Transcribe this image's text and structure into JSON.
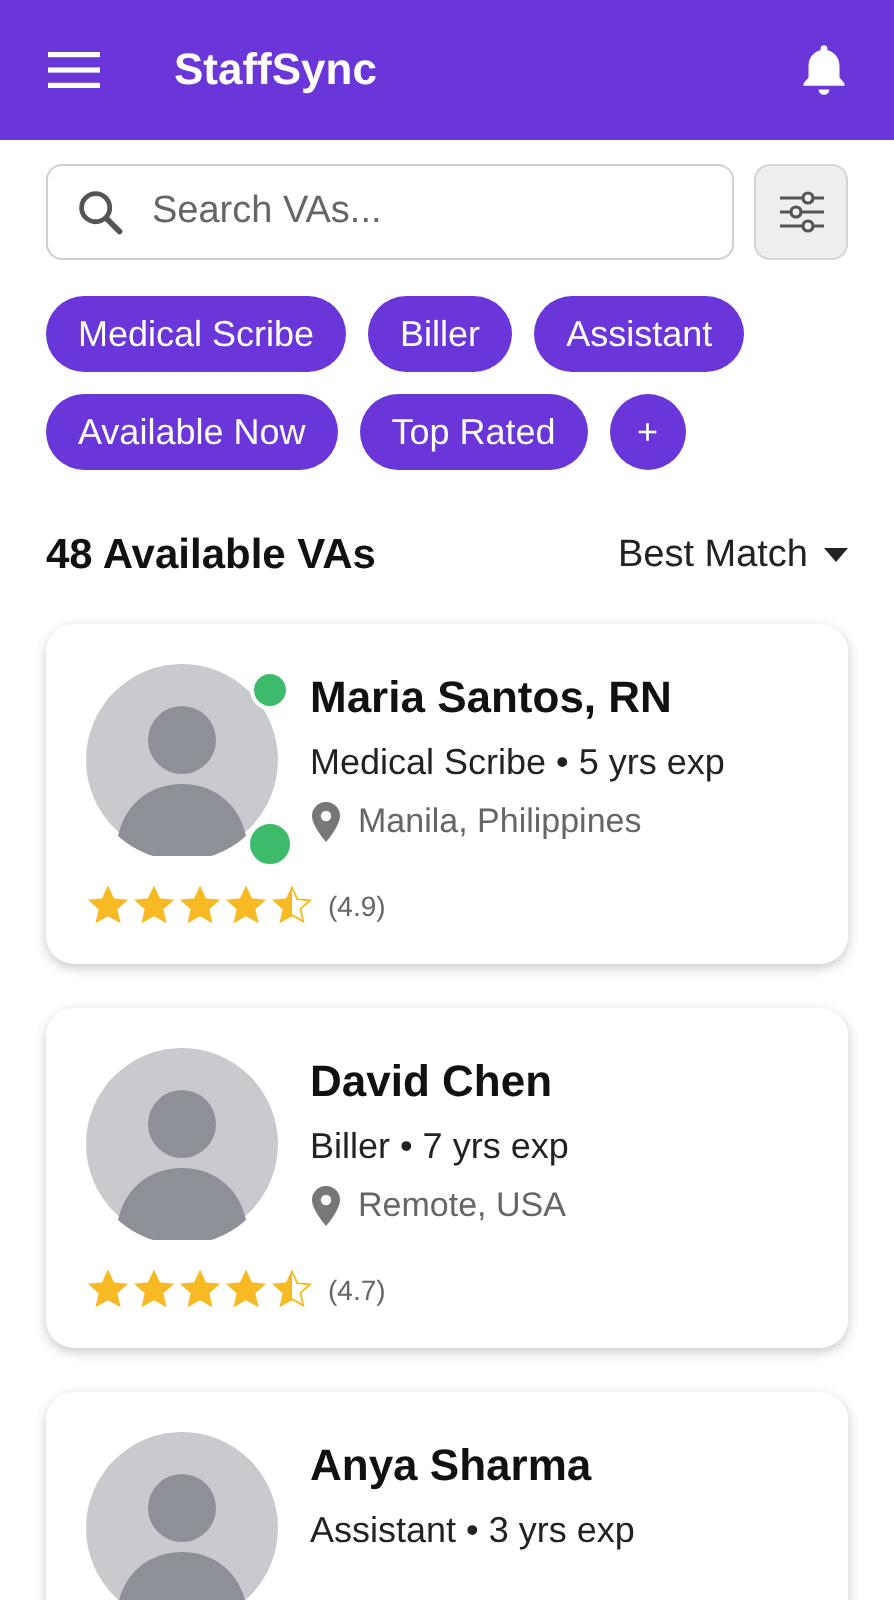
{
  "app_bar": {
    "title": "StaffSync"
  },
  "search": {
    "placeholder": "Search VAs..."
  },
  "chips": [
    {
      "label": "Medical Scribe"
    },
    {
      "label": "Biller"
    },
    {
      "label": "Assistant"
    },
    {
      "label": "Available Now"
    },
    {
      "label": "Top Rated"
    },
    {
      "label": "+"
    }
  ],
  "results": {
    "count_label": "48 Available VAs",
    "sort": "Best Match"
  },
  "cards": [
    {
      "name": "Maria Santos, RN",
      "role": "Medical Scribe • 5 yrs exp",
      "location": "Manila, Philippines",
      "stars": 4.5,
      "rating": "(4.9)",
      "online": true,
      "badge": true
    },
    {
      "name": "David Chen",
      "role": "Biller • 7 yrs exp",
      "location": "Remote, USA",
      "stars": 4.5,
      "rating": "(4.7)",
      "online": false,
      "badge": false
    },
    {
      "name": "Anya Sharma",
      "role": "Assistant • 3 yrs exp",
      "online": false,
      "badge": false
    }
  ]
}
